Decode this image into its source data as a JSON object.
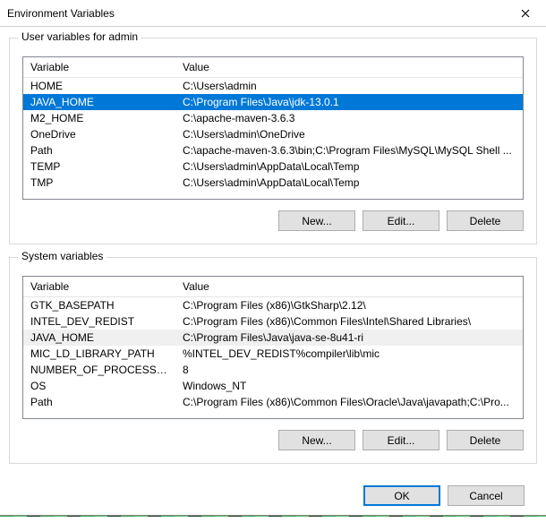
{
  "title": "Environment Variables",
  "userSection": {
    "label": "User variables for admin",
    "columns": {
      "variable": "Variable",
      "value": "Value"
    },
    "rows": [
      {
        "variable": "HOME",
        "value": "C:\\Users\\admin",
        "selected": false,
        "highlight": false
      },
      {
        "variable": "JAVA_HOME",
        "value": "C:\\Program Files\\Java\\jdk-13.0.1",
        "selected": true,
        "highlight": false
      },
      {
        "variable": "M2_HOME",
        "value": "C:\\apache-maven-3.6.3",
        "selected": false,
        "highlight": false
      },
      {
        "variable": "OneDrive",
        "value": "C:\\Users\\admin\\OneDrive",
        "selected": false,
        "highlight": false
      },
      {
        "variable": "Path",
        "value": "C:\\apache-maven-3.6.3\\bin;C:\\Program Files\\MySQL\\MySQL Shell ...",
        "selected": false,
        "highlight": false
      },
      {
        "variable": "TEMP",
        "value": "C:\\Users\\admin\\AppData\\Local\\Temp",
        "selected": false,
        "highlight": false
      },
      {
        "variable": "TMP",
        "value": "C:\\Users\\admin\\AppData\\Local\\Temp",
        "selected": false,
        "highlight": false
      }
    ],
    "buttons": {
      "new": "New...",
      "edit": "Edit...",
      "delete": "Delete"
    }
  },
  "systemSection": {
    "label": "System variables",
    "columns": {
      "variable": "Variable",
      "value": "Value"
    },
    "rows": [
      {
        "variable": "GTK_BASEPATH",
        "value": "C:\\Program Files (x86)\\GtkSharp\\2.12\\",
        "selected": false,
        "highlight": false
      },
      {
        "variable": "INTEL_DEV_REDIST",
        "value": "C:\\Program Files (x86)\\Common Files\\Intel\\Shared Libraries\\",
        "selected": false,
        "highlight": false
      },
      {
        "variable": "JAVA_HOME",
        "value": "C:\\Program Files\\Java\\java-se-8u41-ri",
        "selected": false,
        "highlight": true
      },
      {
        "variable": "MIC_LD_LIBRARY_PATH",
        "value": "%INTEL_DEV_REDIST%compiler\\lib\\mic",
        "selected": false,
        "highlight": false
      },
      {
        "variable": "NUMBER_OF_PROCESSORS",
        "value": "8",
        "selected": false,
        "highlight": false
      },
      {
        "variable": "OS",
        "value": "Windows_NT",
        "selected": false,
        "highlight": false
      },
      {
        "variable": "Path",
        "value": "C:\\Program Files (x86)\\Common Files\\Oracle\\Java\\javapath;C:\\Pro...",
        "selected": false,
        "highlight": false
      }
    ],
    "buttons": {
      "new": "New...",
      "edit": "Edit...",
      "delete": "Delete"
    }
  },
  "dialogButtons": {
    "ok": "OK",
    "cancel": "Cancel"
  }
}
